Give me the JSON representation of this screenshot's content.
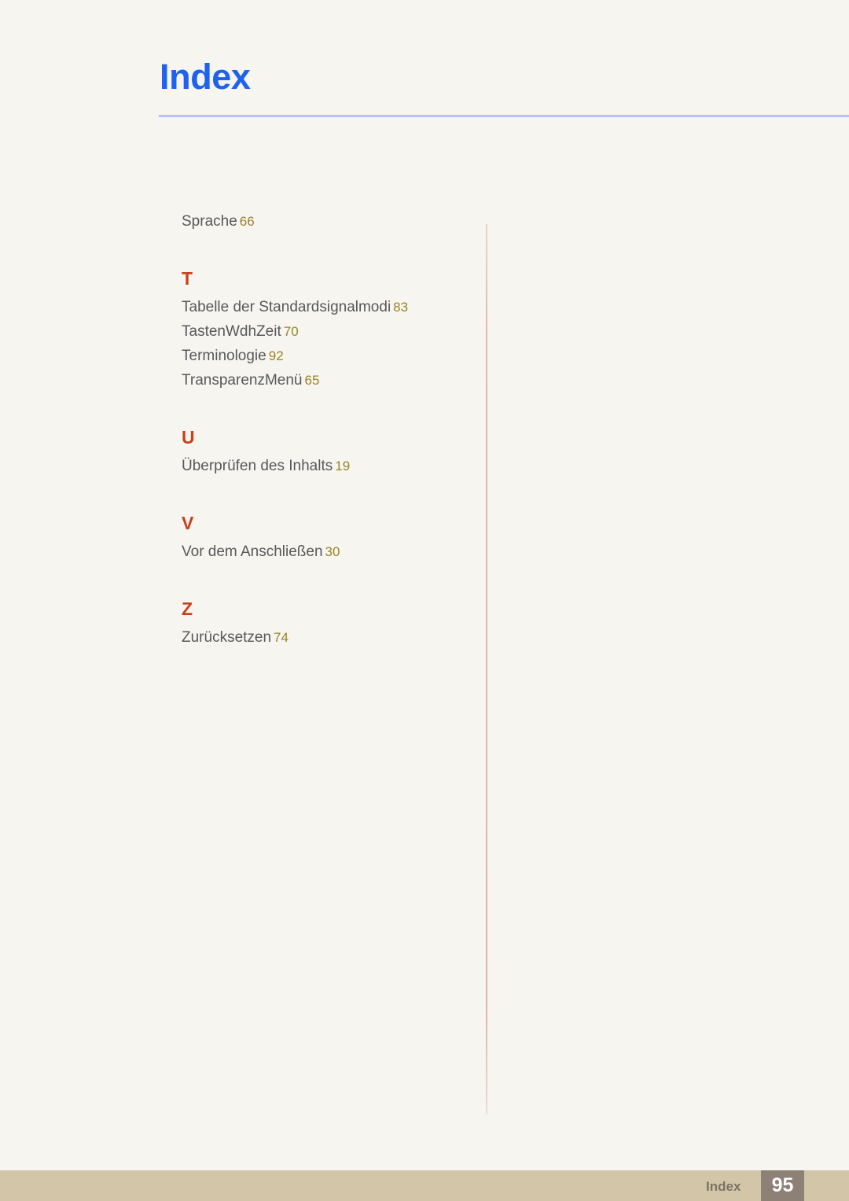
{
  "page": {
    "title": "Index",
    "background_color": "#f6f5ef",
    "title_color": "#1f62ef",
    "rule_color": "#b9bcf5",
    "entry_color": "#58585a",
    "page_number_color": "#9a8328",
    "section_letter_color": "#c8401b"
  },
  "index": {
    "continued_entries": [
      {
        "term": "Sprache",
        "page": "66"
      }
    ],
    "sections": [
      {
        "letter": "T",
        "entries": [
          {
            "term": "Tabelle der Standardsignalmodi",
            "page": "83"
          },
          {
            "term": "TastenWdhZeit",
            "page": "70"
          },
          {
            "term": "Terminologie",
            "page": "92"
          },
          {
            "term": "TransparenzMenü",
            "page": "65"
          }
        ]
      },
      {
        "letter": "U",
        "entries": [
          {
            "term": "Überprüfen des Inhalts",
            "page": "19"
          }
        ]
      },
      {
        "letter": "V",
        "entries": [
          {
            "term": "Vor dem Anschließen",
            "page": "30"
          }
        ]
      },
      {
        "letter": "Z",
        "entries": [
          {
            "term": "Zurücksetzen",
            "page": "74"
          }
        ]
      }
    ]
  },
  "footer": {
    "label": "Index",
    "page_number": "95",
    "band_color": "#d3c6a8",
    "page_box_color": "#8d8176"
  }
}
